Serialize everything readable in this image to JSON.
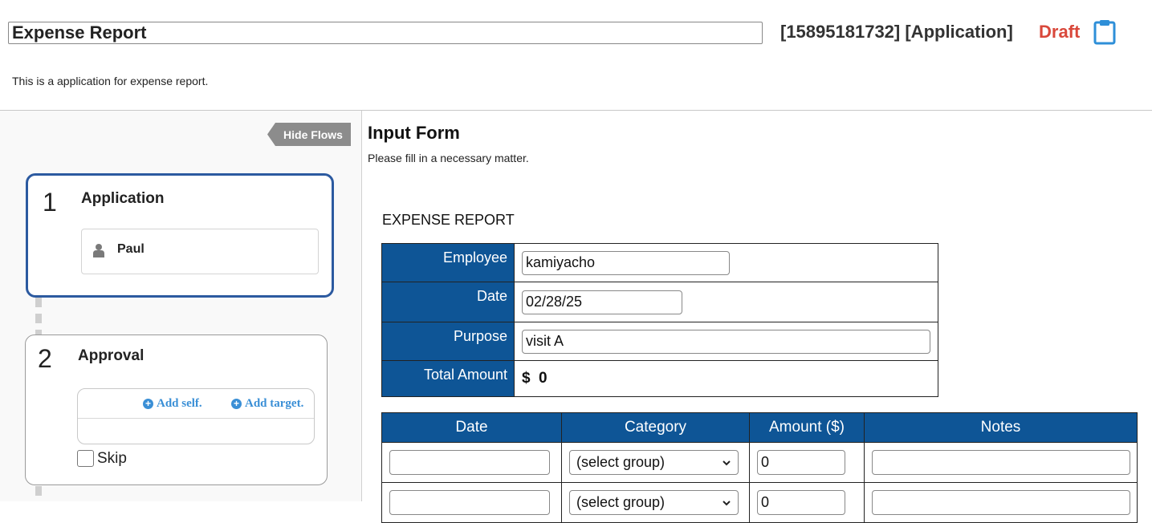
{
  "header": {
    "title": "Expense Report",
    "doc_id": "[15895181732] [Application]",
    "status": "Draft",
    "description": "This is a application for expense report."
  },
  "flows": {
    "hide_label": "Hide Flows",
    "steps": [
      {
        "number": "1",
        "title": "Application",
        "user": "Paul"
      },
      {
        "number": "2",
        "title": "Approval",
        "add_self": "Add self.",
        "add_target": "Add target.",
        "skip_label": "Skip",
        "skip_checked": false
      }
    ]
  },
  "form": {
    "title": "Input Form",
    "subtitle": "Please fill in a necessary matter.",
    "report_title": "EXPENSE REPORT",
    "fields": {
      "employee_label": "Employee",
      "employee_value": "kamiyacho",
      "date_label": "Date",
      "date_value": "02/28/25",
      "purpose_label": "Purpose",
      "purpose_value": "visit A",
      "total_label": "Total Amount",
      "total_currency": "$",
      "total_value": "0"
    },
    "table": {
      "headers": [
        "Date",
        "Category",
        "Amount ($)",
        "Notes"
      ],
      "rows": [
        {
          "date": "",
          "category": "(select group)",
          "amount": "0",
          "notes": ""
        },
        {
          "date": "",
          "category": "(select group)",
          "amount": "0",
          "notes": ""
        }
      ]
    }
  },
  "colors": {
    "accent_blue": "#0e5596",
    "active_border": "#2c5aa0",
    "draft_red": "#d9483b",
    "link_blue": "#3a8fd6"
  }
}
